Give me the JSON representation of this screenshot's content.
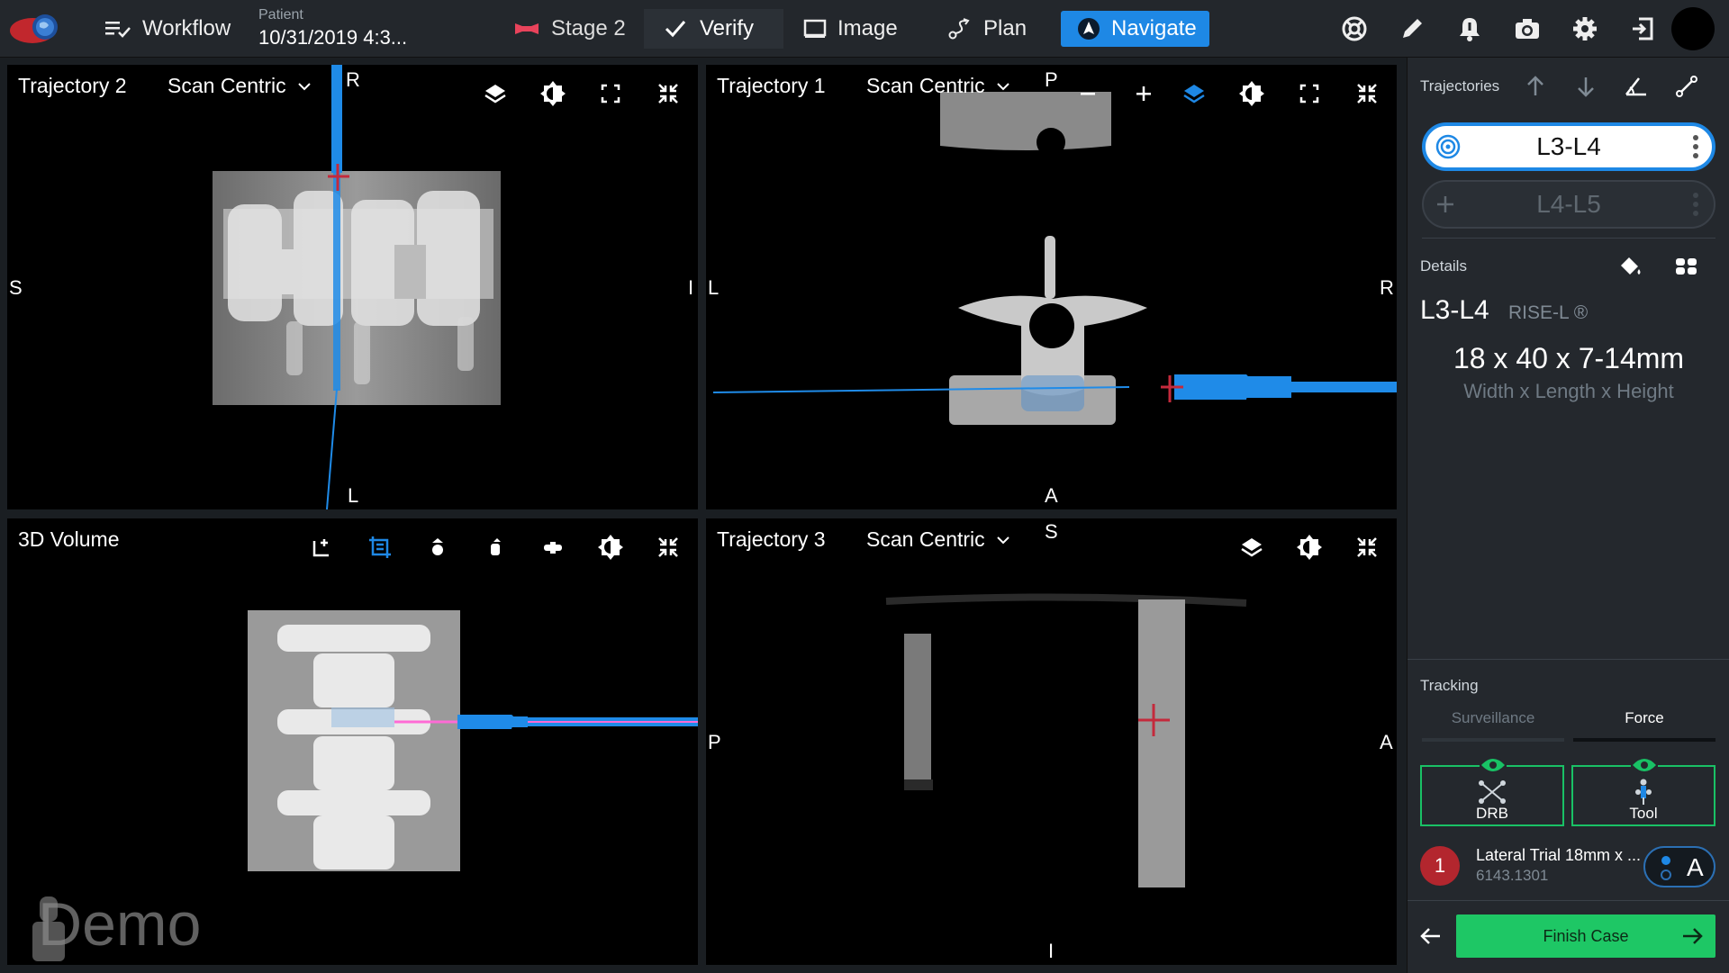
{
  "topbar": {
    "workflow_label": "Workflow",
    "patient_label": "Patient",
    "patient_date": "10/31/2019 4:3...",
    "stage_label": "Stage 2",
    "tabs": [
      {
        "label": "Verify"
      },
      {
        "label": "Image"
      },
      {
        "label": "Plan"
      },
      {
        "label": "Navigate"
      }
    ]
  },
  "viewports": {
    "tl": {
      "title": "Trajectory 2",
      "mode": "Scan Centric",
      "top": "R",
      "left": "S",
      "right": "I",
      "bottom": "L"
    },
    "tr": {
      "title": "Trajectory 1",
      "mode": "Scan Centric",
      "top": "P",
      "left": "L",
      "right": "R",
      "bottom": "A"
    },
    "bl": {
      "title": "3D Volume",
      "watermark": "Demo"
    },
    "br": {
      "title": "Trajectory 3",
      "mode": "Scan Centric",
      "top": "S",
      "left": "P",
      "right": "A",
      "bottom": "I"
    }
  },
  "panel": {
    "trajectories_label": "Trajectories",
    "traj_active": "L3-L4",
    "traj_inactive": "L4-L5",
    "details_label": "Details",
    "level": "L3-L4",
    "implant": "RISE-L ®",
    "dimensions": "18 x 40 x 7-14mm",
    "dimensions_caption": "Width x Length x Height",
    "tracking_label": "Tracking",
    "tracking_tabs": [
      "Surveillance",
      "Force"
    ],
    "drb_label": "DRB",
    "tool_label": "Tool",
    "instrument_index": "1",
    "instrument_name": "Lateral Trial 18mm x ...",
    "instrument_part": "6143.1301",
    "instrument_letter": "A",
    "finish_label": "Finish Case"
  },
  "colors": {
    "accent": "#1e88e5",
    "tracking_green": "#19c165",
    "finish_green": "#1ec765"
  }
}
